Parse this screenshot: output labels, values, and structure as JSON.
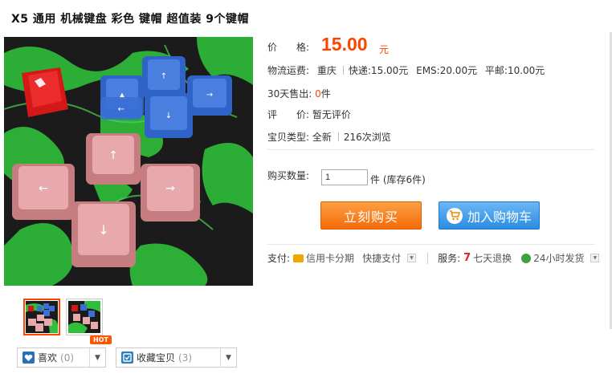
{
  "product": {
    "title": "X5 通用 机械键盘 彩色 键帽 超值装 9个键帽"
  },
  "price": {
    "label": "价　　格:",
    "value": "15.00",
    "unit": "元"
  },
  "shipping": {
    "label": "物流运费:",
    "origin": "重庆",
    "express": "快递:15.00元",
    "ems": "EMS:20.00元",
    "mail": "平邮:10.00元"
  },
  "sales": {
    "label": "30天售出:",
    "count": "0",
    "unit": "件"
  },
  "review": {
    "label": "评　　价:",
    "value": "暂无评价"
  },
  "item_type": {
    "label": "宝贝类型:",
    "condition": "全新",
    "views": "216次浏览"
  },
  "quantity": {
    "label": "购买数量:",
    "value": "1",
    "stock": "件 (库存6件)"
  },
  "actions": {
    "buy_now": "立刻购买",
    "add_to_cart": "加入购物车"
  },
  "payment": {
    "label": "支付:",
    "credit": "信用卡分期",
    "quick": "快捷支付"
  },
  "service": {
    "label": "服务:",
    "return": "七天退换",
    "ship24": "24小时发货"
  },
  "social": {
    "like_label": "喜欢",
    "like_count": "(0)",
    "hot_badge": "HOT",
    "collect_label": "收藏宝贝",
    "collect_count": "(3)"
  },
  "colors": {
    "price": "#ff4400",
    "buy_button": "#f46a08",
    "cart_button": "#2c8de1"
  },
  "icons": {
    "like": "heart-icon",
    "collect": "collect-icon",
    "dropdown": "chevron-down-icon",
    "cart": "cart-icon",
    "credit": "credit-card-icon",
    "return": "seven-day-return-icon",
    "ship24": "fast-ship-icon"
  }
}
